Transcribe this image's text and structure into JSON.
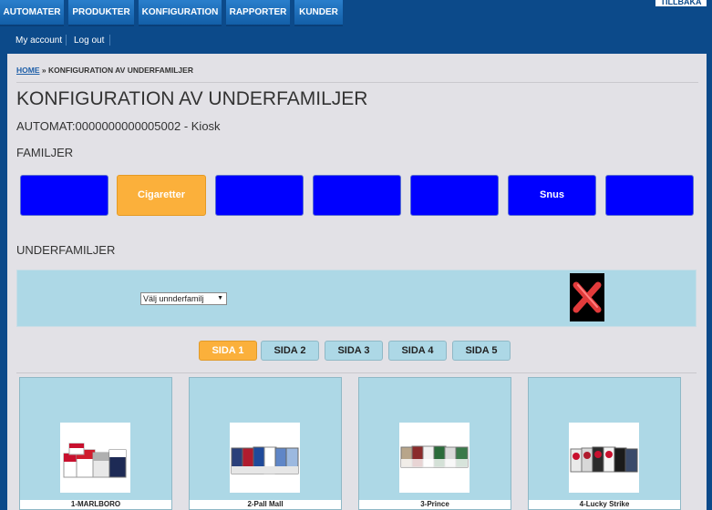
{
  "topnav": {
    "tabs": [
      "AUTOMATER",
      "PRODUKTER",
      "KONFIGURATION",
      "RAPPORTER",
      "KUNDER"
    ],
    "corner_label": "TILLBAKA"
  },
  "subnav": {
    "my_account": "My account",
    "logout": "Log out"
  },
  "breadcrumb": {
    "home": "HOME",
    "sep": "»",
    "current": "KONFIGURATION AV UNDERFAMILJER"
  },
  "page": {
    "title": "KONFIGURATION AV UNDERFAMILJER",
    "automat": "AUTOMAT:0000000000005002 - Kiosk",
    "families_heading": "FAMILJER",
    "subfamilies_heading": "UNDERFAMILJER"
  },
  "families": [
    "",
    "Cigaretter",
    "",
    "",
    "",
    "Snus",
    ""
  ],
  "active_family": 1,
  "subfamily_select": {
    "value": "Välj unnderfamilj"
  },
  "pagination": [
    "SIDA 1",
    "SIDA 2",
    "SIDA 3",
    "SIDA 4",
    "SIDA 5"
  ],
  "active_page": 0,
  "products": [
    "1-MARLBORO",
    "2-Pall Mall",
    "3-Prince",
    "4-Lucky Strike"
  ],
  "colors": {
    "nav": "#0c4a8a",
    "family_button": "#0000ff",
    "active": "#fbb03b",
    "panel": "#add8e6"
  },
  "icons": {
    "remove": "close-x-icon",
    "select_arrow": "chevron-down-icon"
  }
}
